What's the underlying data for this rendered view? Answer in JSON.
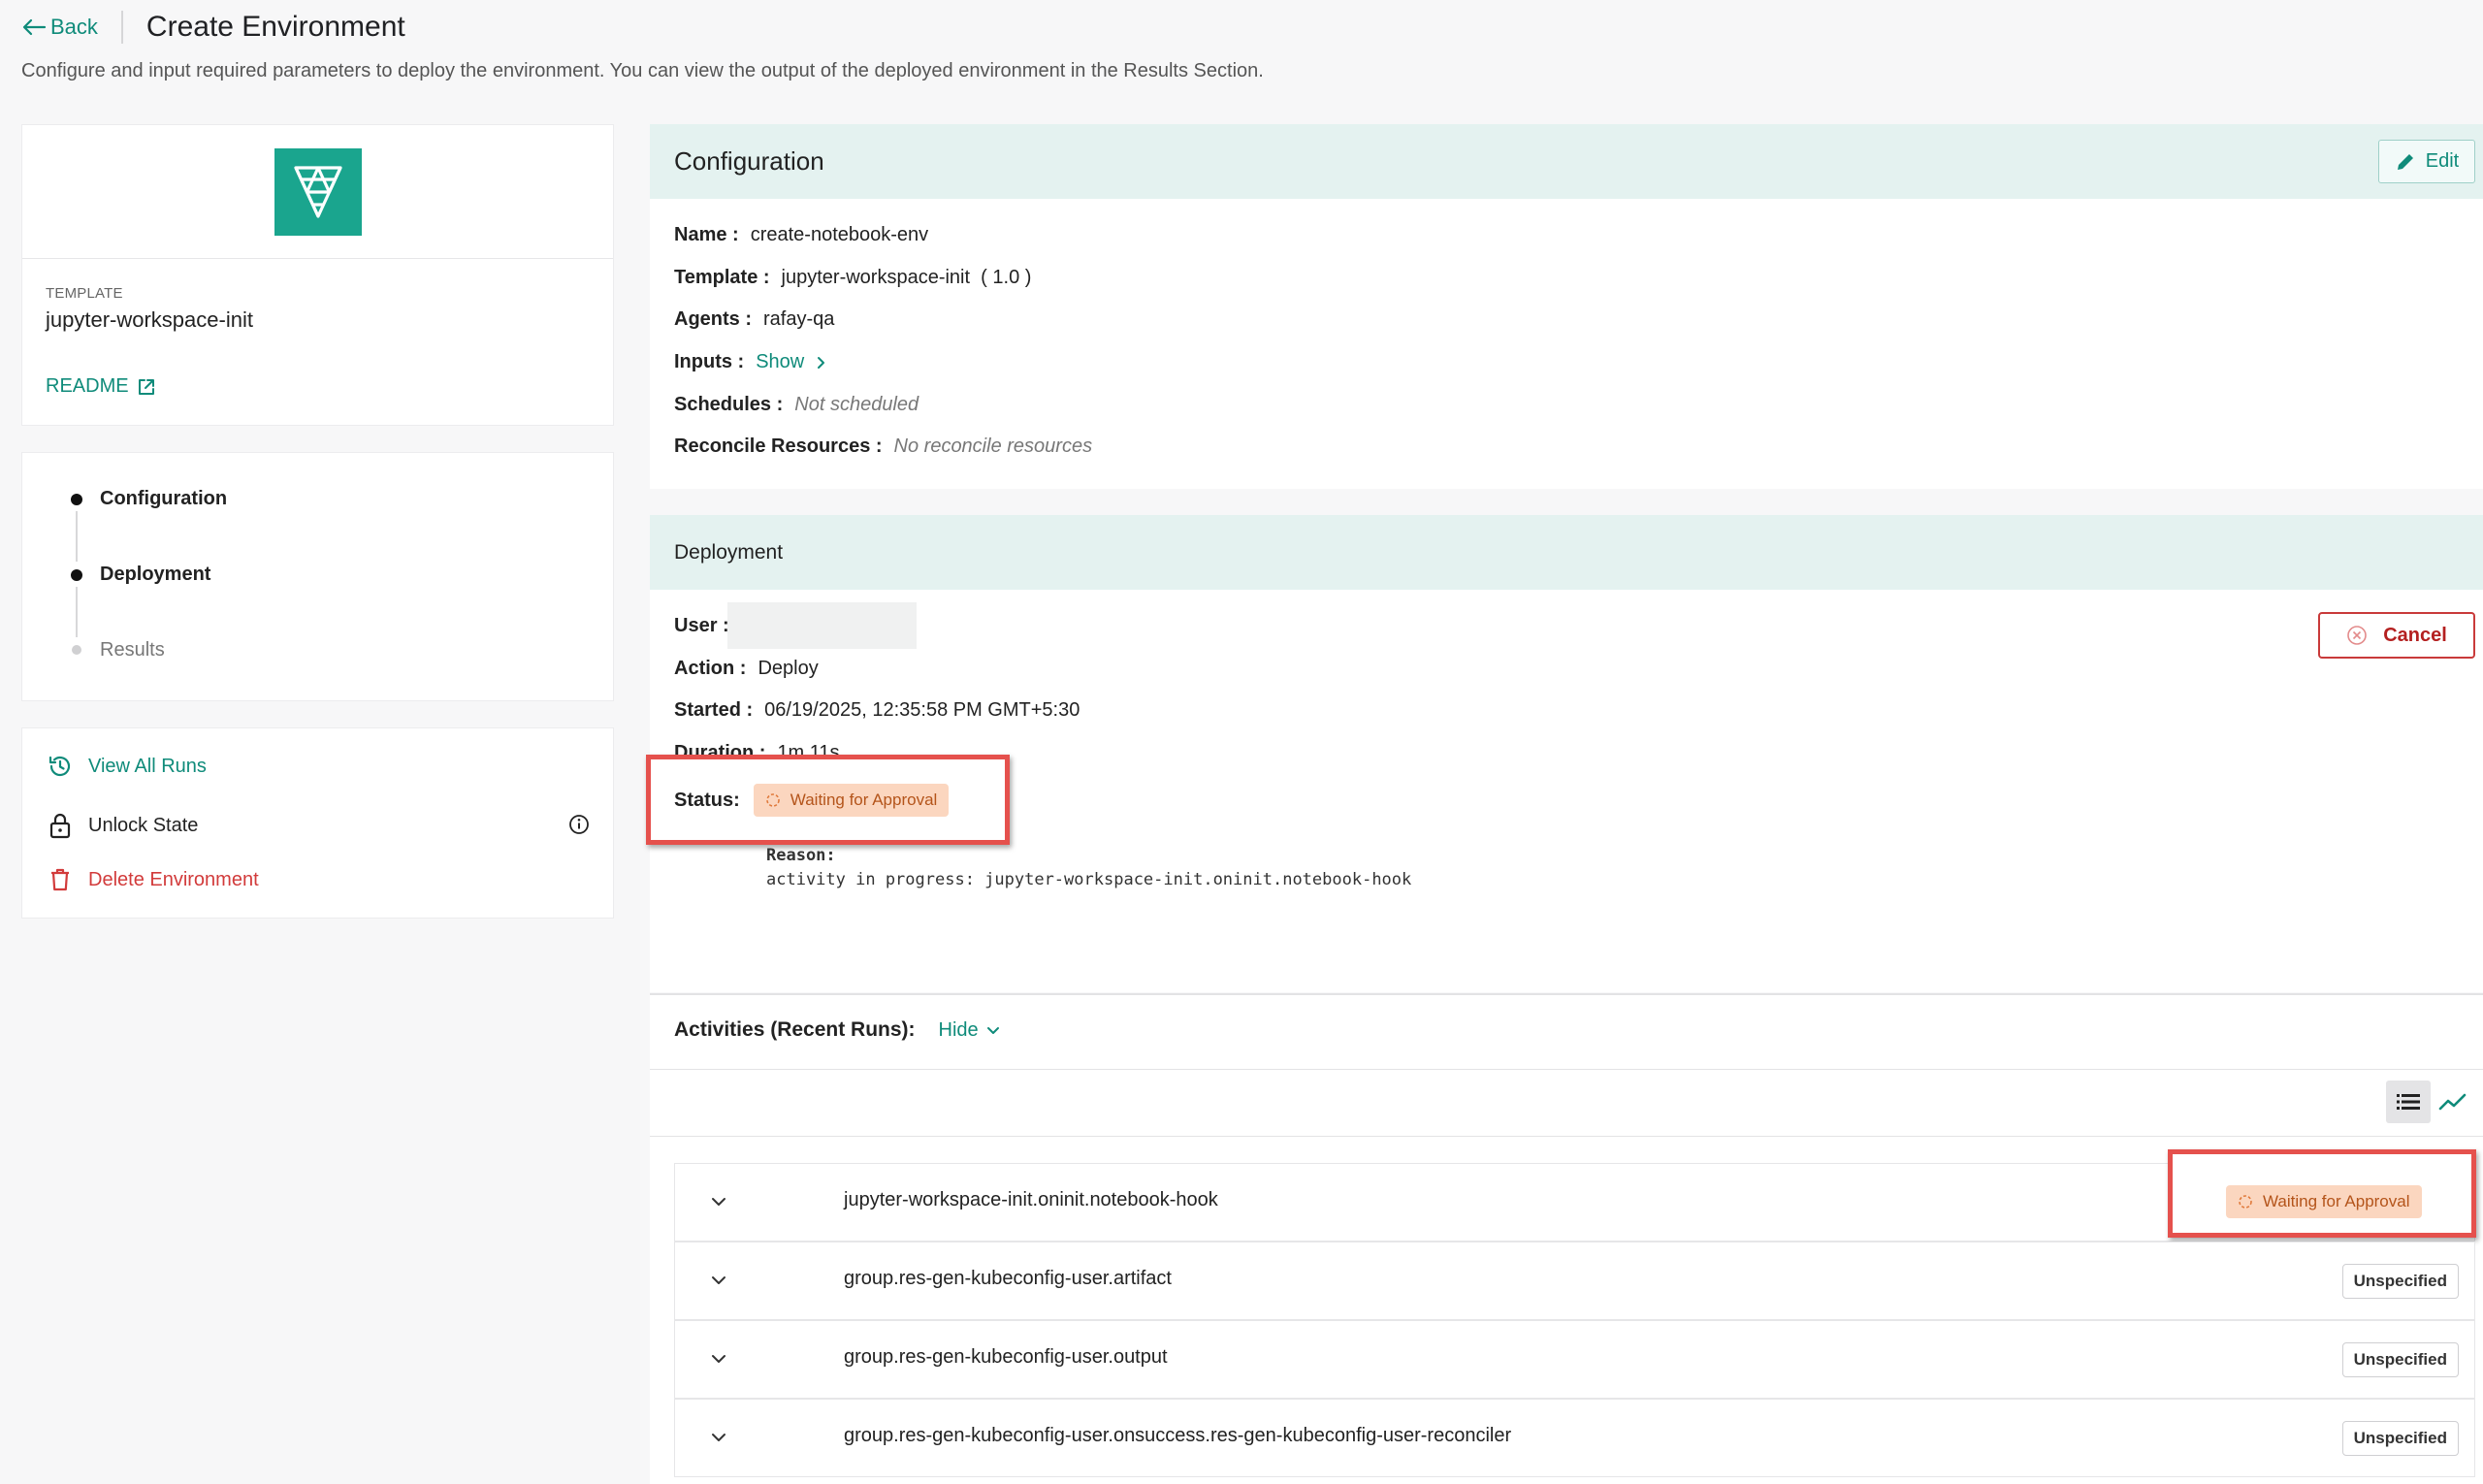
{
  "header": {
    "back_label": "Back",
    "title": "Create Environment",
    "subtitle": "Configure and input required parameters to deploy the environment. You can view the output of the deployed environment in the Results Section."
  },
  "template_card": {
    "label": "TEMPLATE",
    "name": "jupyter-workspace-init",
    "readme_label": "README"
  },
  "steps": [
    {
      "label": "Configuration",
      "state": "done"
    },
    {
      "label": "Deployment",
      "state": "done"
    },
    {
      "label": "Results",
      "state": "pending"
    }
  ],
  "actions": {
    "view_all_runs": "View All Runs",
    "unlock_state": "Unlock State",
    "delete_environment": "Delete Environment"
  },
  "configuration": {
    "title": "Configuration",
    "edit_label": "Edit",
    "name_key": "Name :",
    "name_value": "create-notebook-env",
    "template_key": "Template :",
    "template_value": "jupyter-workspace-init  ( 1.0 )",
    "agents_key": "Agents :",
    "agents_value": "rafay-qa",
    "inputs_key": "Inputs :",
    "inputs_link": "Show",
    "schedules_key": "Schedules :",
    "schedules_value": "Not scheduled",
    "reconcile_key": "Reconcile Resources :",
    "reconcile_value": "No reconcile resources"
  },
  "deployment": {
    "title": "Deployment",
    "user_key": "User :",
    "action_key": "Action :",
    "action_value": "Deploy",
    "started_key": "Started :",
    "started_value": "06/19/2025, 12:35:58 PM GMT+5:30",
    "duration_key": "Duration :",
    "duration_value": "1m 11s",
    "status_key": "Status:",
    "status_value": "Waiting for Approval",
    "reason_label": "Reason:",
    "reason_value": "activity in progress: jupyter-workspace-init.oninit.notebook-hook",
    "cancel_label": "Cancel"
  },
  "activities": {
    "title": "Activities (Recent Runs):",
    "hide_label": "Hide",
    "rows": [
      {
        "name": "jupyter-workspace-init.oninit.notebook-hook",
        "status": "Waiting for Approval"
      },
      {
        "name": "group.res-gen-kubeconfig-user.artifact",
        "status": "Unspecified"
      },
      {
        "name": "group.res-gen-kubeconfig-user.output",
        "status": "Unspecified"
      },
      {
        "name": "group.res-gen-kubeconfig-user.onsuccess.res-gen-kubeconfig-user-reconciler",
        "status": "Unspecified"
      }
    ]
  },
  "colors": {
    "accent": "#0f8b7a",
    "section_header_bg": "#e4f2f0",
    "waiting_badge_bg": "#fbd6bf",
    "waiting_badge_text": "#b4541a",
    "danger": "#c93a3a",
    "highlight_box": "#e5514d"
  }
}
